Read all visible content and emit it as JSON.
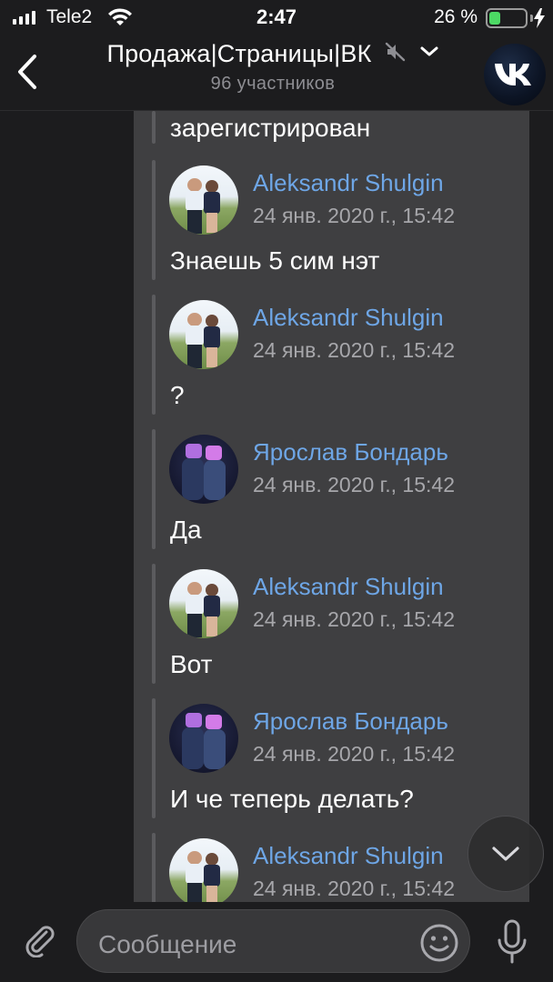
{
  "status_bar": {
    "carrier": "Tele2",
    "time": "2:47",
    "battery_percent_text": "26 %",
    "battery_level": 0.26,
    "icons": [
      "signal-icon",
      "wifi-icon",
      "battery-icon",
      "charging-bolt-icon"
    ]
  },
  "header": {
    "title": "Продажа|Страницы|ВК",
    "subtitle": "96 участников",
    "icons": [
      "back-chevron-icon",
      "muted-speaker-icon",
      "chevron-down-icon",
      "vk-logo-icon"
    ]
  },
  "chat": {
    "top_partial_text": "зарегистрирован",
    "messages": [
      {
        "author": "Aleksandr Shulgin",
        "date": "24 янв. 2020 г., 15:42",
        "text": "Знаешь 5 сим нэт"
      },
      {
        "author": "Aleksandr Shulgin",
        "date": "24 янв. 2020 г., 15:42",
        "text": "?"
      },
      {
        "author": "Ярослав Бондарь",
        "date": "24 янв. 2020 г., 15:42",
        "text": "Да"
      },
      {
        "author": "Aleksandr Shulgin",
        "date": "24 янв. 2020 г., 15:42",
        "text": "Вот"
      },
      {
        "author": "Ярослав Бондарь",
        "date": "24 янв. 2020 г., 15:42",
        "text": "И че теперь делать?"
      },
      {
        "author": "Aleksandr Shulgin",
        "date": "24 янв. 2020 г., 15:42",
        "text": ""
      }
    ]
  },
  "input": {
    "placeholder": "Сообщение",
    "icons": [
      "paperclip-icon",
      "emoji-icon",
      "microphone-icon",
      "scroll-down-chevron-icon"
    ]
  },
  "colors": {
    "background": "#1c1c1e",
    "panel": "#3f3f41",
    "author_name": "#6ea6e6",
    "battery_fill": "#4cd964"
  }
}
